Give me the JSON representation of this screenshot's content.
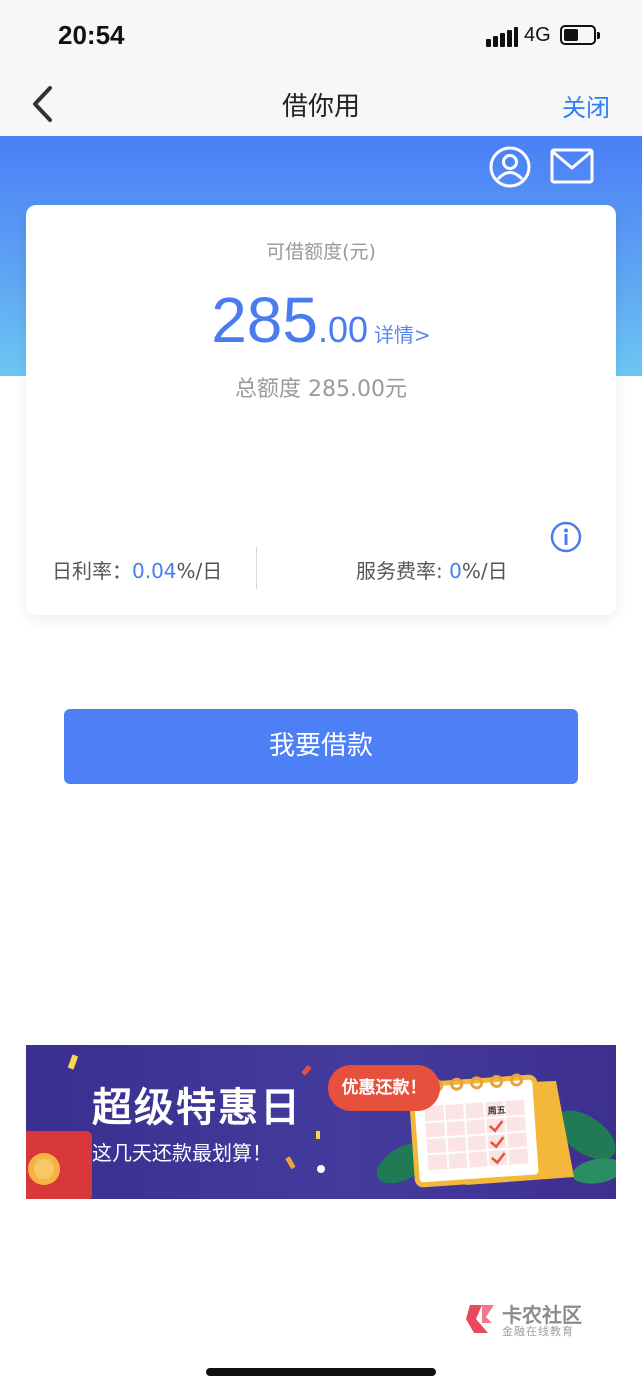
{
  "status_bar": {
    "time": "20:54",
    "network": "4G"
  },
  "nav": {
    "title": "借你用",
    "close_label": "关闭"
  },
  "card": {
    "credit_label": "可借额度(元)",
    "amount_integer": "285",
    "amount_decimal": ".00",
    "detail_link": "详情>",
    "total_label": "总额度 285.00元",
    "daily_rate_label": "日利率：",
    "daily_rate_value": "0.04",
    "daily_rate_unit": "%/日",
    "service_fee_label": "服务费率: ",
    "service_fee_value": "0",
    "service_fee_unit": "%/日"
  },
  "actions": {
    "borrow_label": "我要借款"
  },
  "banner": {
    "title": "超级特惠日",
    "subtitle": "这几天还款最划算！",
    "tag": "优惠还款！",
    "calendar_day": "周五"
  },
  "watermark": {
    "title": "卡农社区",
    "subtitle": "金融在线教育"
  },
  "colors": {
    "accent": "#4d7ff6",
    "link": "#2e7cf6",
    "banner_bg": "#3a2f8f",
    "tag_red": "#e8503e"
  },
  "icons": [
    "back-icon",
    "user-icon",
    "mail-icon",
    "info-icon"
  ]
}
